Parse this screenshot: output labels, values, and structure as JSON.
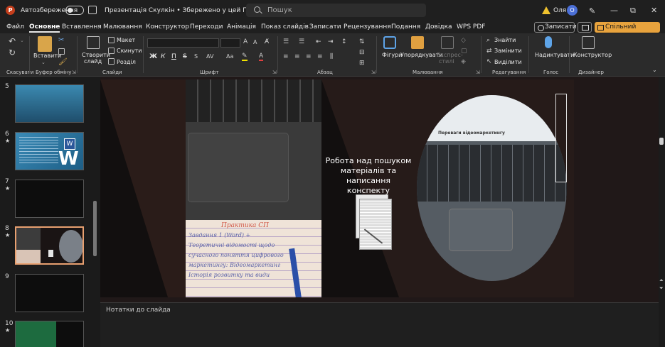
{
  "titlebar": {
    "autosave_label": "Автозбереження",
    "document_title": "Презентація Скулкін • Збережено у цей ПК",
    "search_placeholder": "Пошук",
    "user_name": "Оля",
    "avatar_initial": "О"
  },
  "menu": {
    "items": [
      "Файл",
      "Основне",
      "Вставлення",
      "Малювання",
      "Конструктор",
      "Переходи",
      "Анімація",
      "Показ слайдів",
      "Записати",
      "Рецензування",
      "Подання",
      "Довідка",
      "WPS PDF"
    ],
    "active": "Основне",
    "record_label": "Записати",
    "share_label": "Спільний доступ"
  },
  "ribbon": {
    "groups": {
      "undo": "Скасувати",
      "clipboard": "Буфер обміну",
      "slides": "Слайди",
      "font": "Шрифт",
      "paragraph": "Абзац",
      "drawing": "Малювання",
      "editing": "Редагування",
      "voice": "Голос",
      "designer": "Дизайнер"
    },
    "paste": "Вставити",
    "new_slide": [
      "Створити",
      "слайд"
    ],
    "layout": "Макет",
    "reset": "Скинути",
    "section": "Розділ",
    "shapes": "Фігури",
    "arrange": "Упорядкувати",
    "quick_styles": [
      "Експрес-",
      "стилі"
    ],
    "find": "Знайти",
    "replace": "Замінити",
    "select": "Виділити",
    "dictate": "Надиктувати",
    "designer_btn": "Конструктор",
    "font_bold": "Ж",
    "font_italic": "К",
    "font_underline": "П",
    "font_strike": "S"
  },
  "thumbnails": [
    {
      "number": "5",
      "starred": false
    },
    {
      "number": "6",
      "starred": true
    },
    {
      "number": "7",
      "starred": true
    },
    {
      "number": "8",
      "starred": true
    },
    {
      "number": "9",
      "starred": false
    },
    {
      "number": "10",
      "starred": true
    }
  ],
  "star_glyph": "★",
  "slide": {
    "title": "Робота над пошуком матеріалів та написання конспекту",
    "notebook_text": [
      "Практика СП",
      "Завдання 1 (Word) +",
      "Теоретичні відомості щодо",
      "сучасного поняття цифрового",
      "маркетингу: Відеомаркетинг",
      "Історія розвитку та види"
    ],
    "screen_heading": "Переваги відеомаркетингу"
  },
  "notes_placeholder": "Нотатки до слайда",
  "colors": {
    "accent": "#e8a33d",
    "selection": "#e8a070",
    "background": "#1f1f1f",
    "ribbon": "#2b2b2b"
  }
}
